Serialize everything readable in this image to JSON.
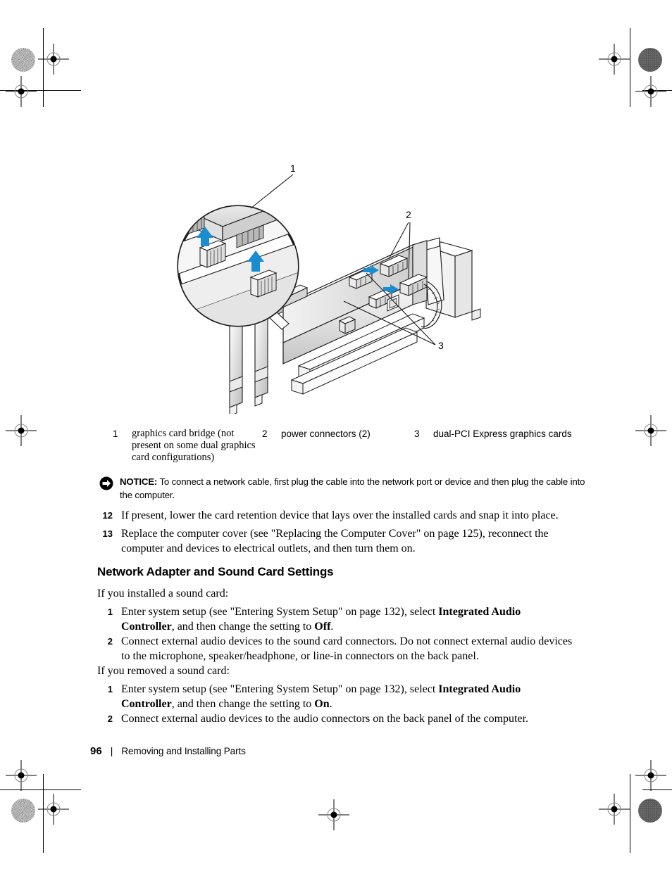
{
  "document": {
    "page_number": "96",
    "footer_separator": "|",
    "footer_title": "Removing and Installing Parts"
  },
  "figure": {
    "callouts": [
      {
        "id": "1",
        "label": "1"
      },
      {
        "id": "2",
        "label": "2"
      },
      {
        "id": "3",
        "label": "3"
      }
    ],
    "arrow_color": "#1a8cd0",
    "caption_items": [
      {
        "num": "1",
        "text": "graphics card bridge (not present on some dual graphics card configurations)",
        "font": "serif"
      },
      {
        "num": "2",
        "text": "power connectors (2)",
        "font": "sans"
      },
      {
        "num": "3",
        "text": "dual-PCI Express graphics cards",
        "font": "sans"
      }
    ]
  },
  "notice": {
    "icon": "notice-arrow-icon",
    "label": "NOTICE:",
    "text": "To connect a network cable, first plug the cable into the network port or device and then plug the cable into the computer."
  },
  "steps_top": [
    {
      "num": "12",
      "text": "If present, lower the card retention device that lays over the installed cards and snap it into place."
    },
    {
      "num": "13",
      "text": "Replace the computer cover (see \"Replacing the Computer Cover\" on page 125), reconnect the computer and devices to electrical outlets, and then turn them on."
    }
  ],
  "section": {
    "heading": "Network Adapter and Sound Card Settings",
    "intro_installed": "If you installed a sound card:",
    "intro_removed": "If you removed a sound card:"
  },
  "steps_installed": [
    {
      "num": "1",
      "pre": "Enter system setup (see \"Entering System Setup\" on page 132), select ",
      "bold1": "Integrated Audio Controller",
      "mid": ", and then change the setting to ",
      "bold2": "Off",
      "post": "."
    },
    {
      "num": "2",
      "pre": "Connect external audio devices to the sound card connectors. Do not connect external audio devices to the microphone, speaker/headphone, or line-in connectors on the back panel.",
      "bold1": "",
      "mid": "",
      "bold2": "",
      "post": ""
    }
  ],
  "steps_removed": [
    {
      "num": "1",
      "pre": "Enter system setup (see \"Entering System Setup\" on page 132), select ",
      "bold1": "Integrated Audio Controller",
      "mid": ", and then change the setting to ",
      "bold2": "On",
      "post": "."
    },
    {
      "num": "2",
      "pre": "Connect external audio devices to the audio connectors on the back panel of the computer.",
      "bold1": "",
      "mid": "",
      "bold2": "",
      "post": ""
    }
  ]
}
